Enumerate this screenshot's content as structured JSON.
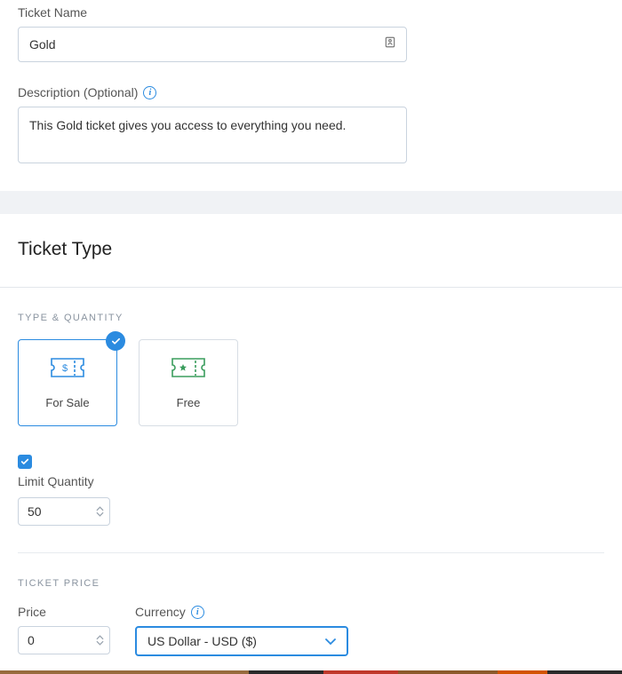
{
  "ticket_name": {
    "label": "Ticket Name",
    "value": "Gold"
  },
  "description": {
    "label": "Description (Optional)",
    "value": "This Gold ticket gives you access to everything you need."
  },
  "section_title": "Ticket Type",
  "type_quantity": {
    "header": "TYPE & QUANTITY",
    "for_sale": "For Sale",
    "free": "Free"
  },
  "limit_quantity": {
    "label": "Limit Quantity",
    "value": "50",
    "checked": true
  },
  "ticket_price": {
    "header": "TICKET PRICE",
    "price_label": "Price",
    "price_value": "0",
    "currency_label": "Currency",
    "currency_value": "US Dollar - USD ($)"
  }
}
